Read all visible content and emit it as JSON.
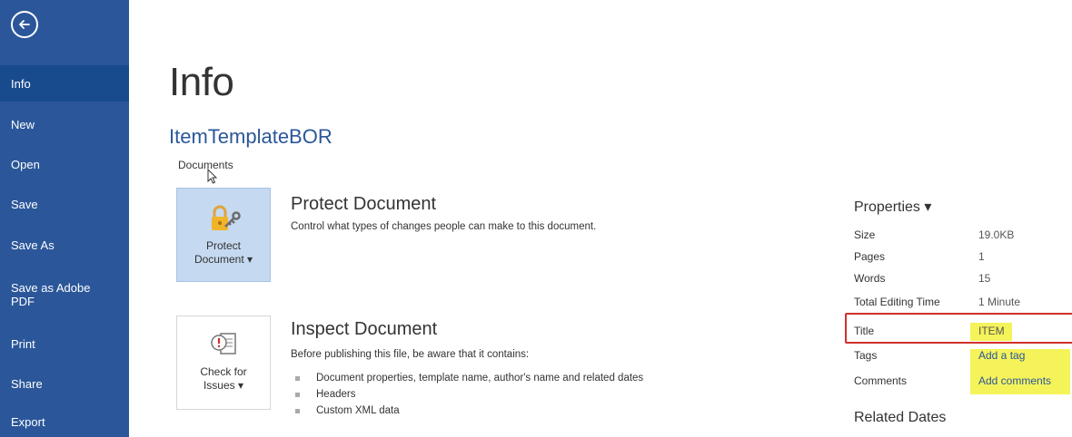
{
  "sidebar": {
    "items": [
      {
        "label": "Info",
        "active": true
      },
      {
        "label": "New"
      },
      {
        "label": "Open"
      },
      {
        "label": "Save"
      },
      {
        "label": "Save As"
      },
      {
        "label": "Save as Adobe PDF"
      },
      {
        "label": "Print"
      },
      {
        "label": "Share"
      },
      {
        "label": "Export"
      }
    ]
  },
  "main": {
    "title": "Info",
    "doc_name": "ItemTemplateBOR",
    "doc_location": "Documents",
    "protect": {
      "tile_label_line1": "Protect",
      "tile_label_line2": "Document ▾",
      "heading": "Protect Document",
      "description": "Control what types of changes people can make to this document."
    },
    "inspect": {
      "tile_label_line1": "Check for",
      "tile_label_line2": "Issues ▾",
      "heading": "Inspect Document",
      "description": "Before publishing this file, be aware that it contains:",
      "bullets": [
        "Document properties, template name, author's name and related dates",
        "Headers",
        "Custom XML data"
      ]
    }
  },
  "properties": {
    "heading": "Properties ▾",
    "rows": [
      {
        "key": "Size",
        "value": "19.0KB"
      },
      {
        "key": "Pages",
        "value": "1"
      },
      {
        "key": "Words",
        "value": "15"
      },
      {
        "key": "Total Editing Time",
        "value": "1 Minute"
      },
      {
        "key": "Title",
        "value": "ITEM"
      },
      {
        "key": "Tags",
        "value": "Add a tag"
      },
      {
        "key": "Comments",
        "value": "Add comments"
      }
    ],
    "related_dates_heading": "Related Dates"
  },
  "colors": {
    "accent": "#2b579a",
    "highlight": "#f5f35a",
    "annotation_box": "#d0302a"
  }
}
